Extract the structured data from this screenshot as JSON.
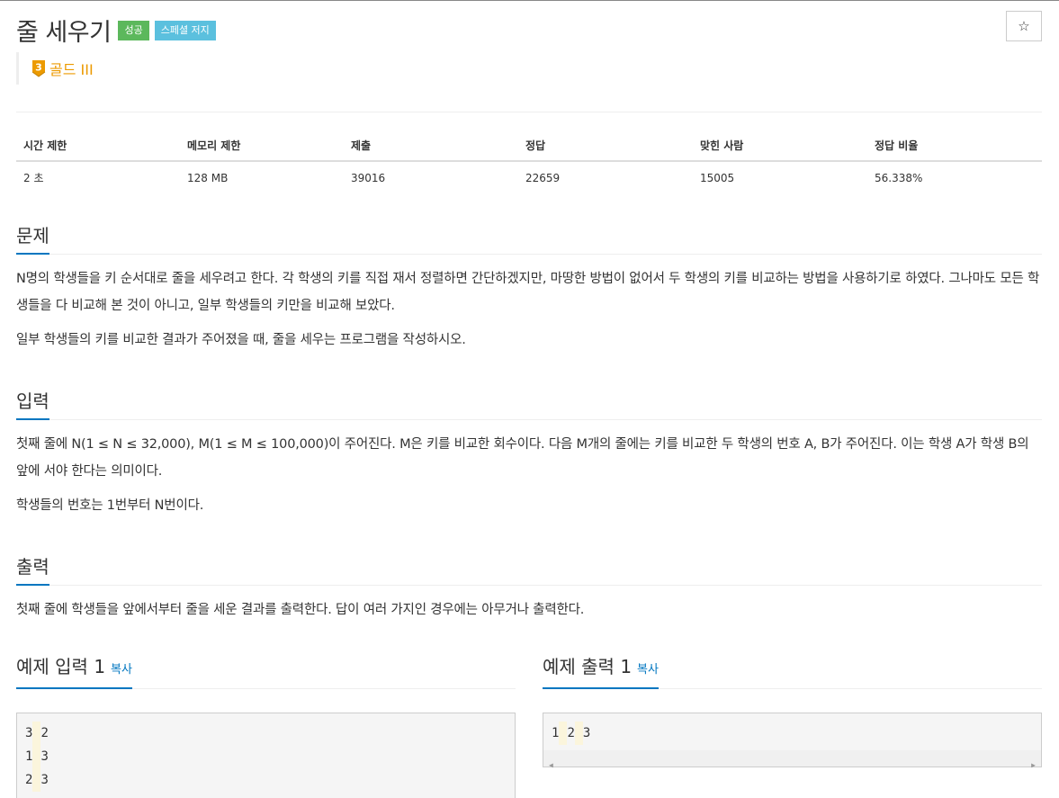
{
  "problem": {
    "title": "줄 세우기",
    "badges": {
      "success": "성공",
      "special_judge": "스페셜 저지"
    },
    "tier": {
      "number": "3",
      "label": "골드 III",
      "color": "#ec9a00"
    }
  },
  "toolbar": {
    "star_glyph": "☆"
  },
  "info_table": {
    "headers": [
      "시간 제한",
      "메모리 제한",
      "제출",
      "정답",
      "맞힌 사람",
      "정답 비율"
    ],
    "values": [
      "2 초",
      "128 MB",
      "39016",
      "22659",
      "15005",
      "56.338%"
    ]
  },
  "sections": {
    "problem": {
      "title": "문제",
      "paragraphs": [
        "N명의 학생들을 키 순서대로 줄을 세우려고 한다. 각 학생의 키를 직접 재서 정렬하면 간단하겠지만, 마땅한 방법이 없어서 두 학생의 키를 비교하는 방법을 사용하기로 하였다. 그나마도 모든 학생들을 다 비교해 본 것이 아니고, 일부 학생들의 키만을 비교해 보았다.",
        "일부 학생들의 키를 비교한 결과가 주어졌을 때, 줄을 세우는 프로그램을 작성하시오."
      ]
    },
    "input": {
      "title": "입력",
      "paragraphs": [
        "첫째 줄에 N(1 ≤ N ≤ 32,000), M(1 ≤ M ≤ 100,000)이 주어진다. M은 키를 비교한 회수이다. 다음 M개의 줄에는 키를 비교한 두 학생의 번호 A, B가 주어진다. 이는 학생 A가 학생 B의 앞에 서야 한다는 의미이다.",
        "학생들의 번호는 1번부터 N번이다."
      ]
    },
    "output": {
      "title": "출력",
      "paragraphs": [
        "첫째 줄에 학생들을 앞에서부터 줄을 세운 결과를 출력한다. 답이 여러 가지인 경우에는 아무거나 출력한다."
      ]
    }
  },
  "samples": {
    "input": {
      "title": "예제 입력 1",
      "copy_label": "복사",
      "lines": [
        [
          "3",
          "2"
        ],
        [
          "1",
          "3"
        ],
        [
          "2",
          "3"
        ]
      ]
    },
    "output": {
      "title": "예제 출력 1",
      "copy_label": "복사",
      "lines": [
        [
          "1",
          "2",
          "3"
        ]
      ]
    }
  },
  "colors": {
    "success": "#5cb85c",
    "special": "#5bc0de",
    "accent": "#0076c0",
    "code_space": "#fbf5dc"
  }
}
